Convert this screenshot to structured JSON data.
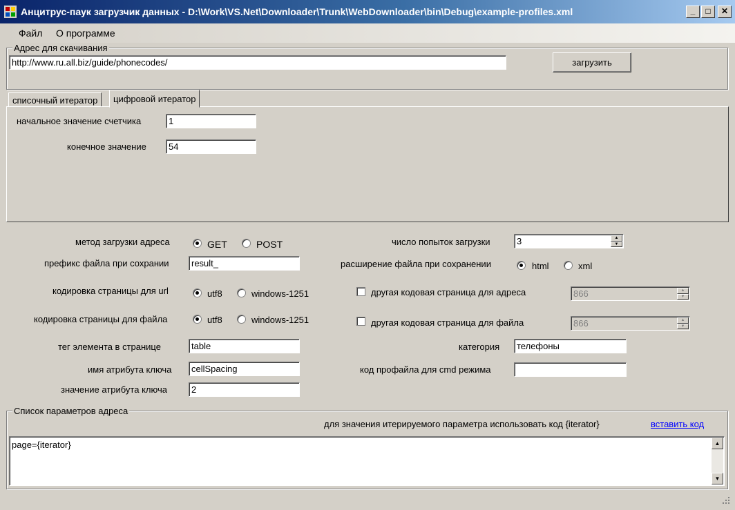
{
  "window": {
    "title": "Анцитрус-паук загрузчик данных  - D:\\Work\\VS.Net\\Downloader\\Trunk\\WebDownloader\\bin\\Debug\\example-profiles.xml",
    "minimize": "_",
    "maximize": "□",
    "close": "✕"
  },
  "menu": {
    "file": "Файл",
    "about": "О программе"
  },
  "address": {
    "group_label": "Адрес для скачивания",
    "url": "http://www.ru.all.biz/guide/phonecodes/",
    "load_button": "загрузить"
  },
  "tabs": [
    {
      "label": "списочный итератор",
      "active": false
    },
    {
      "label": "цифровой итератор",
      "active": true
    }
  ],
  "iterator": {
    "start_label": "начальное значение счетчика",
    "start_value": "1",
    "end_label": "конечное значение",
    "end_value": "54"
  },
  "settings": {
    "method_label": "метод загрузки адреса",
    "method_get": "GET",
    "method_post": "POST",
    "method_selected": "GET",
    "prefix_label": "префикс файла при сохрании",
    "prefix_value": "result_",
    "url_enc_label": "кодировка страницы для url",
    "file_enc_label": "кодировка страницы для файла",
    "enc_utf8": "utf8",
    "enc_1251": "windows-1251",
    "tag_label": "тег элемента в странице",
    "tag_value": "table",
    "attr_name_label": "имя атрибута ключа",
    "attr_name_value": "cellSpacing",
    "attr_value_label": "значение атрибута ключа",
    "attr_value_value": "2",
    "attempts_label": "число попыток загрузки",
    "attempts_value": "3",
    "ext_label": "расширение файла при сохранении",
    "ext_html": "html",
    "ext_xml": "xml",
    "other_cp_url_label": "другая кодовая страница для адреса",
    "other_cp_url_value": "866",
    "other_cp_file_label": "другая кодовая страница для файла",
    "other_cp_file_value": "866",
    "category_label": "категория",
    "category_value": "телефоны",
    "cmd_label": "код профайла для  cmd режима",
    "cmd_value": ""
  },
  "params": {
    "group_label": "Список параметров адреса",
    "hint": "для значения итерируемого параметра использовать код {iterator}",
    "insert_link": "вставить код",
    "text": "page={iterator}"
  }
}
